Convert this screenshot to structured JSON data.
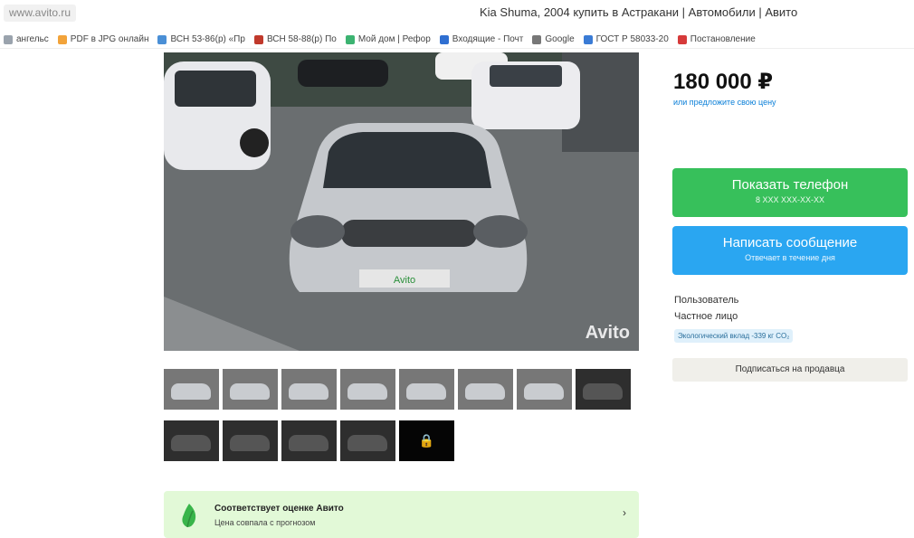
{
  "browser": {
    "url": "www.avito.ru",
    "title": "Kia Shuma, 2004 купить в Астракани | Автомобили | Авито"
  },
  "bookmarks": [
    {
      "label": "ангельс",
      "icon": "bookmark-icon",
      "color": "#9aa3ad"
    },
    {
      "label": "PDF в JPG онлайн",
      "icon": "pdf-icon",
      "color": "#f2a33a"
    },
    {
      "label": "ВСН 53-86(р) «Пр",
      "icon": "snowflake-icon",
      "color": "#4a8fd6"
    },
    {
      "label": "ВСН 58-88(р) По",
      "icon": "document-icon",
      "color": "#c0392b"
    },
    {
      "label": "Мой дом | Рефор",
      "icon": "grid-icon",
      "color": "#3cb371"
    },
    {
      "label": "Входящие - Почт",
      "icon": "mail-icon",
      "color": "#2f6fd1"
    },
    {
      "label": "Google",
      "icon": "google-icon",
      "color": "#777777"
    },
    {
      "label": "ГОСТ Р 58033-20",
      "icon": "link-icon",
      "color": "#3a7bd5"
    },
    {
      "label": "Постановление",
      "icon": "flag-icon",
      "color": "#d63a3a"
    }
  ],
  "photo": {
    "watermark": "Avito",
    "plate": "Avito"
  },
  "thumbnails": [
    {
      "type": "exterior"
    },
    {
      "type": "exterior"
    },
    {
      "type": "exterior"
    },
    {
      "type": "exterior"
    },
    {
      "type": "exterior"
    },
    {
      "type": "exterior"
    },
    {
      "type": "exterior"
    },
    {
      "type": "interior"
    },
    {
      "type": "interior"
    },
    {
      "type": "interior"
    },
    {
      "type": "interior"
    },
    {
      "type": "interior"
    },
    {
      "type": "locked"
    }
  ],
  "listing": {
    "price": "180 000 ₽",
    "price_sub": "или предложите свою цену",
    "phone_button": {
      "label": "Показать телефон",
      "sub": "8 XXX XXX-XX-XX"
    },
    "message_button": {
      "label": "Написать сообщение",
      "sub": "Отвечает в течение дня"
    },
    "seller_type": "Пользователь",
    "seller_kind": "Частное лицо",
    "eco_badge": "Экологический вклад -339 кг CO₂",
    "subscribe": "Подписаться на продавца"
  },
  "rating": {
    "title": "Соответствует оценке Авито",
    "subtitle": "Цена совпала с прогнозом",
    "chevron": "›"
  },
  "colors": {
    "phone": "#37c05b",
    "message": "#2aa6f1",
    "rating_bg": "#e2f9d7",
    "link": "#0a7fd8"
  }
}
